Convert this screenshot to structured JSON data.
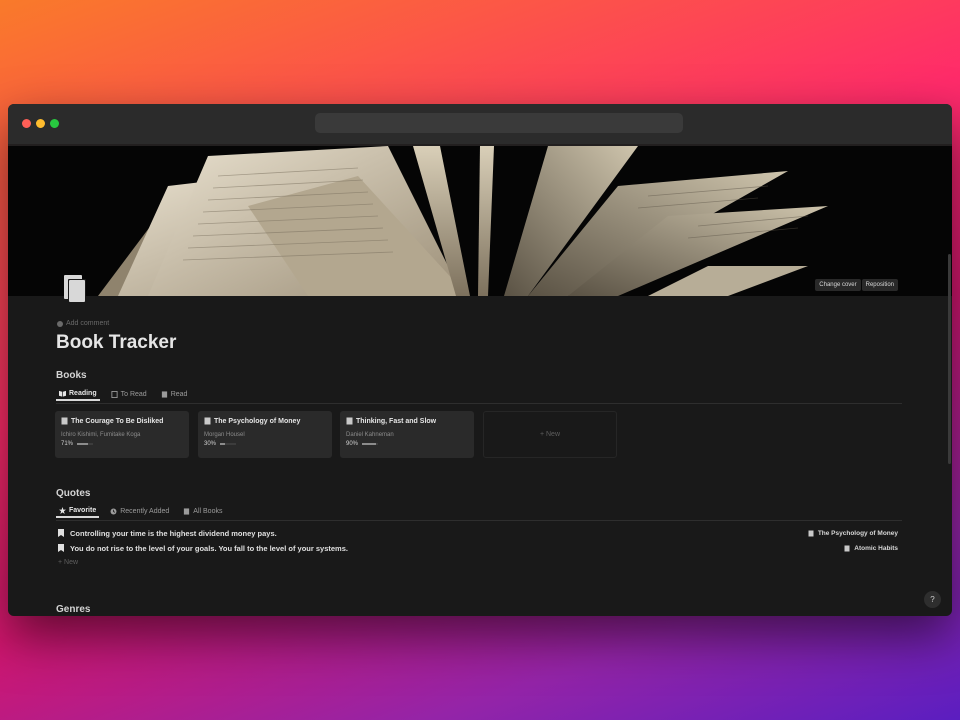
{
  "window": {
    "url": ""
  },
  "cover": {
    "change_label": "Change cover",
    "reposition_label": "Reposition"
  },
  "page": {
    "add_comment": "Add comment",
    "title": "Book Tracker"
  },
  "books": {
    "title": "Books",
    "tabs": [
      {
        "label": "Reading",
        "active": true
      },
      {
        "label": "To Read",
        "active": false
      },
      {
        "label": "Read",
        "active": false
      }
    ],
    "cards": [
      {
        "title": "The Courage To Be Disliked",
        "author": "Ichiro Kishimi, Fumitake Koga",
        "progress_label": "71%",
        "progress": 0.71
      },
      {
        "title": "The Psychology of Money",
        "author": "Morgan Housel",
        "progress_label": "30%",
        "progress": 0.3
      },
      {
        "title": "Thinking, Fast and Slow",
        "author": "Daniel Kahneman",
        "progress_label": "90%",
        "progress": 0.9
      }
    ],
    "new_label": "+ New"
  },
  "quotes": {
    "title": "Quotes",
    "tabs": [
      {
        "label": "Favorite",
        "active": true
      },
      {
        "label": "Recently Added",
        "active": false
      },
      {
        "label": "All Books",
        "active": false
      }
    ],
    "rows": [
      {
        "text": "Controlling your time is the highest dividend money pays.",
        "source": "The Psychology of Money"
      },
      {
        "text": "You do not rise to the level of your goals. You fall to the level of your systems.",
        "source": "Atomic Habits"
      }
    ],
    "new_label": "+ New"
  },
  "genres": {
    "title": "Genres"
  },
  "help": {
    "label": "?"
  },
  "colors": {
    "background": "#191919",
    "card": "#2a2a2a",
    "text": "#e6e6e6"
  }
}
